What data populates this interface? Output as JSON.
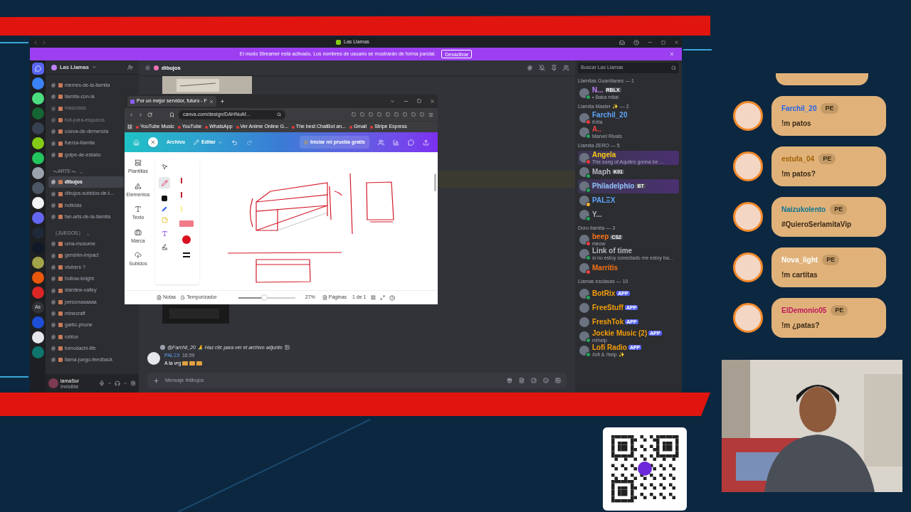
{
  "discord": {
    "title": "Las Llamas",
    "streamer_banner": {
      "text": "El modo Streamer está activado. Los nombres de usuario se mostrarán de forma parcial.",
      "button": "Desactivar"
    },
    "servers": [
      {
        "kind": "home"
      },
      {
        "kind": "avatar",
        "color": "#3b82f6"
      },
      {
        "kind": "avatar",
        "color": "#4ade80"
      },
      {
        "kind": "avatar",
        "color": "#166534"
      },
      {
        "kind": "avatar",
        "color": "#374151"
      },
      {
        "kind": "avatar",
        "color": "#84cc16"
      },
      {
        "kind": "avatar",
        "color": "#22c55e"
      },
      {
        "kind": "avatar",
        "color": "#9ca3af"
      },
      {
        "kind": "avatar",
        "color": "#4b5563"
      },
      {
        "kind": "avatar",
        "color": "#f3f4f6"
      },
      {
        "kind": "avatar",
        "color": "#6366f1"
      },
      {
        "kind": "avatar",
        "color": "#1f2937"
      },
      {
        "kind": "avatar",
        "color": "#111827"
      },
      {
        "kind": "avatar",
        "color": "#a3a34a"
      },
      {
        "kind": "avatar",
        "color": "#ea580c"
      },
      {
        "kind": "avatar",
        "color": "#dc2626"
      },
      {
        "kind": "text",
        "label": "As"
      },
      {
        "kind": "avatar",
        "color": "#1d4ed8"
      },
      {
        "kind": "avatar",
        "color": "#e5e7eb"
      },
      {
        "kind": "avatar",
        "color": "#0f766e"
      }
    ],
    "server_name": "Las Llamas",
    "channels": [
      {
        "kind": "channel",
        "name": "memes-de-la-llamita",
        "muted": false,
        "selected": false
      },
      {
        "kind": "channel",
        "name": "llamita-con-ia",
        "muted": false,
        "selected": false
      },
      {
        "kind": "channel",
        "name": "mascotas",
        "muted": true,
        "selected": false
      },
      {
        "kind": "channel",
        "name": "bot-para-esquizos",
        "muted": true,
        "selected": false
      },
      {
        "kind": "channel",
        "name": "cueva-de-demencia",
        "muted": false,
        "selected": false
      },
      {
        "kind": "channel",
        "name": "fuerza-llamita",
        "muted": false,
        "selected": false
      },
      {
        "kind": "channel",
        "name": "golpe-de-estado",
        "muted": false,
        "selected": false
      },
      {
        "kind": "category",
        "name": "ᯓARTEᯓ"
      },
      {
        "kind": "channel",
        "name": "dibujos",
        "muted": false,
        "selected": true
      },
      {
        "kind": "channel",
        "name": "dibujos-subidos-de-t...",
        "muted": false,
        "selected": false
      },
      {
        "kind": "channel",
        "name": "noticias",
        "muted": false,
        "selected": false
      },
      {
        "kind": "channel",
        "name": "fan-arts-de-la-llamita",
        "muted": false,
        "selected": false
      },
      {
        "kind": "category",
        "name": "［JUEGOS］"
      },
      {
        "kind": "channel",
        "name": "uma-musume",
        "muted": false,
        "selected": false
      },
      {
        "kind": "channel",
        "name": "genshin-impact",
        "muted": false,
        "selected": false
      },
      {
        "kind": "channel",
        "name": "vtubers ?",
        "muted": false,
        "selected": false
      },
      {
        "kind": "channel",
        "name": "hollow-knight",
        "muted": false,
        "selected": false
      },
      {
        "kind": "channel",
        "name": "stardew-valley",
        "muted": false,
        "selected": false
      },
      {
        "kind": "channel",
        "name": "personaaaaaa",
        "muted": false,
        "selected": false
      },
      {
        "kind": "channel",
        "name": "minecraft",
        "muted": false,
        "selected": false
      },
      {
        "kind": "channel",
        "name": "gartic-phone",
        "muted": false,
        "selected": false
      },
      {
        "kind": "channel",
        "name": "roblox",
        "muted": false,
        "selected": false
      },
      {
        "kind": "channel",
        "name": "tomodachi-life",
        "muted": false,
        "selected": false
      },
      {
        "kind": "channel",
        "name": "llama-juego-feedback",
        "muted": false,
        "selected": false
      }
    ],
    "user": {
      "name": "lamaSor",
      "status": "Invisible"
    },
    "channel_header": "dibujos",
    "search": {
      "placeholder": "Buscar Las Llamas"
    },
    "message": {
      "reply": "@Farchil_20 🙏 Haz clic para ver el archivo adjunto",
      "author": "PALΞX",
      "time": "16:59",
      "text": "A la vrg"
    },
    "composer": {
      "placeholder": "Mensaje #dibujos"
    },
    "member_groups": [
      {
        "title": "Llamitas Guardianes — 1",
        "members": [
          {
            "kind": "online",
            "name": "N...",
            "color": "#c084fc",
            "tag": "RBLX",
            "activity": "• Baka mitai",
            "banner": false
          }
        ]
      },
      {
        "title": "Llamita Master ✨ — 2",
        "members": [
          {
            "kind": "dnd",
            "name": "Farchil_20",
            "color": "#60a5fa",
            "activity": "Krita",
            "banner": false
          },
          {
            "kind": "online",
            "name": "A..",
            "color": "#ef4444",
            "activity": "Marvel Rivals",
            "banner": false
          }
        ]
      },
      {
        "title": "Llamita ZERO — 5",
        "members": [
          {
            "kind": "dnd",
            "name": "Angela",
            "color": "#facc15",
            "activity": "The song of Aquiles gonna be ...",
            "banner": true
          },
          {
            "kind": "online",
            "name": "Maph",
            "color": "#b5bac1",
            "tag": "K01",
            "banner": false
          },
          {
            "kind": "online",
            "name": "Philadelphio",
            "color": "#93c5fd",
            "tag": "BT",
            "banner": true
          },
          {
            "kind": "idle",
            "name": "PALΞX",
            "color": "#60a5fa",
            "banner": false
          },
          {
            "kind": "online",
            "name": "Y...",
            "color": "#b5bac1",
            "banner": false
          }
        ]
      },
      {
        "title": "Doro llamita — 3",
        "members": [
          {
            "kind": "dnd",
            "name": "beep",
            "color": "#f97316",
            "tag": "CS2",
            "activity": "meow",
            "banner": false
          },
          {
            "kind": "mobile",
            "name": "Link of time",
            "color": "#b5bac1",
            "activity": "si no estoy conectado me estoy ba...",
            "banner": false
          },
          {
            "kind": "dnd",
            "name": "Marritis",
            "color": "#f97316",
            "banner": false
          }
        ]
      },
      {
        "title": "Llamas esclavas — 10",
        "members": [
          {
            "kind": "online",
            "name": "BotRix",
            "color": "#f59e0b",
            "tag": "APP",
            "banner": false
          },
          {
            "kind": "bot",
            "name": "FreeStuff",
            "color": "#f59e0b",
            "tag": "APP",
            "banner": false
          },
          {
            "kind": "bot",
            "name": "FreshTok",
            "color": "#f59e0b",
            "tag": "APP",
            "banner": false
          },
          {
            "kind": "online",
            "name": "Jockie Music (2)",
            "color": "#f59e0b",
            "tag": "APP",
            "activity": "m!help",
            "banner": false
          },
          {
            "kind": "online",
            "name": "Lofi Radio",
            "color": "#f59e0b",
            "tag": "APP",
            "activity": "/lofi & /help ✨",
            "banner": false
          }
        ]
      }
    ]
  },
  "browser": {
    "tab": "Por un mejor servidor, futuro - F",
    "url": "canva.com/design/DAHNuAf...",
    "bookmarks": [
      "YouTube Music",
      "YouTube",
      "WhatsApp",
      "Ver Anime Online G...",
      "The best ChatBot an...",
      "Gmail",
      "Stripe Express"
    ],
    "canva": {
      "file_menu": "Archivo",
      "edit": "Editar",
      "trial": "Iniciar mi prueba gratis",
      "side_items": [
        "Plantillas",
        "Elementos",
        "Texto",
        "Marca",
        "Subidos"
      ],
      "notes": "Notas",
      "timer": "Temporizador",
      "zoom": {
        "level": 0.45,
        "reading": "27%"
      },
      "pages": "Páginas",
      "page_count": "1 de 1"
    }
  },
  "chat": [
    {
      "user": "Farchil_20",
      "color": "#2563eb",
      "badge": "PE",
      "text": "!m patos"
    },
    {
      "user": "estufa_04",
      "color": "#a16207",
      "badge": "PE",
      "text": "!m patos?"
    },
    {
      "user": "Naizukolento",
      "color": "#0e7490",
      "badge": "PE",
      "text": "#QuieroSerlamitaVip"
    },
    {
      "user": "Nova_light",
      "color": "#ffffff",
      "badge": "PE",
      "text": "!m cartitas"
    },
    {
      "user": "ElDemonio05",
      "color": "#be185d",
      "badge": "PE",
      "text": "!m ¿patas?"
    }
  ]
}
